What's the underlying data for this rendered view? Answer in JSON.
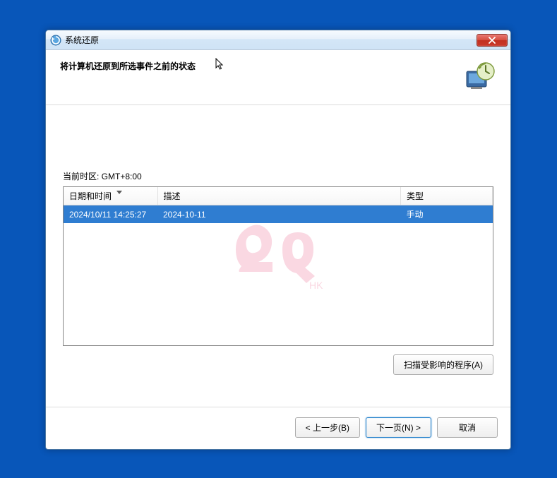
{
  "window": {
    "title": "系统还原"
  },
  "header": {
    "title": "将计算机还原到所选事件之前的状态"
  },
  "content": {
    "timezone_label": "当前时区: GMT+8:00",
    "columns": {
      "datetime": "日期和时间",
      "description": "描述",
      "type": "类型"
    },
    "rows": [
      {
        "datetime": "2024/10/11 14:25:27",
        "description": "2024-10-11",
        "type": "手动"
      }
    ],
    "scan_button": "扫描受影响的程序(A)"
  },
  "footer": {
    "back": "< 上一步(B)",
    "next": "下一页(N) >",
    "cancel": "取消"
  },
  "watermark": "2Q"
}
